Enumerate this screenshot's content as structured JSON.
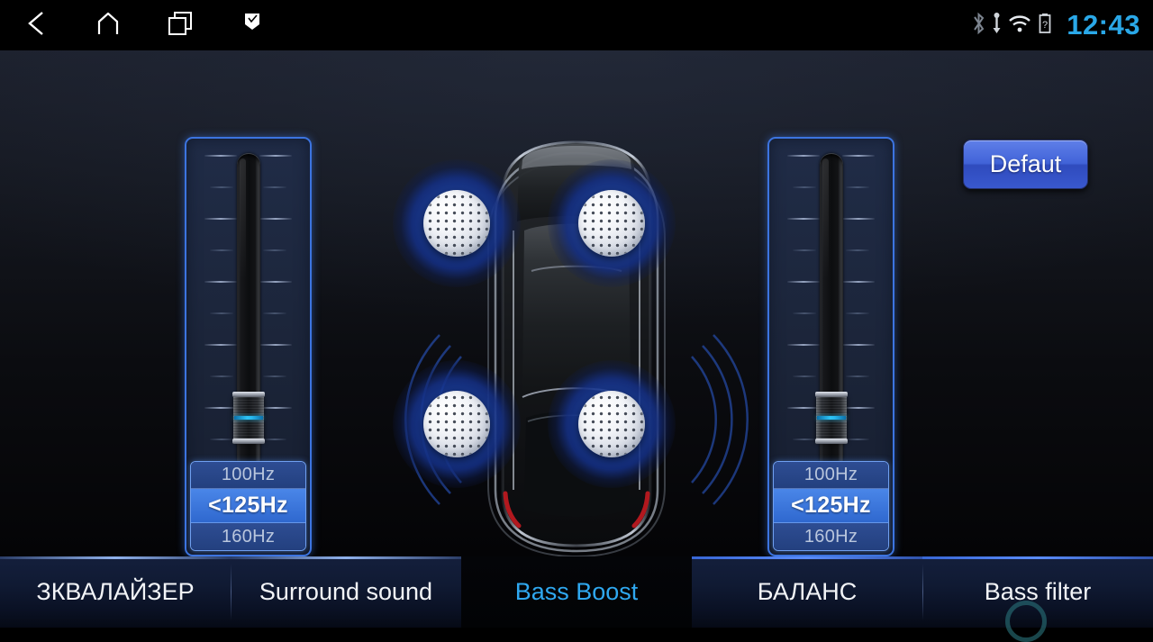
{
  "statusbar": {
    "nav": [
      {
        "name": "back-icon",
        "label": "back"
      },
      {
        "name": "home-icon",
        "label": "home"
      },
      {
        "name": "recent-apps-icon",
        "label": "recent apps"
      },
      {
        "name": "flag-icon",
        "label": "flag"
      }
    ],
    "indicators": [
      {
        "name": "bluetooth-icon",
        "label": "bluetooth"
      },
      {
        "name": "usb-icon",
        "label": "usb"
      },
      {
        "name": "wifi-icon",
        "label": "wifi"
      },
      {
        "name": "battery-unknown-icon",
        "label": "battery"
      }
    ],
    "clock": "12:43",
    "clock_color": "#2aa8e8"
  },
  "default_button": {
    "label": "Defaut"
  },
  "sliders": [
    {
      "id": "bass-boost-left",
      "level_percent": 8,
      "frequencies": [
        {
          "label": "100Hz",
          "selected": false
        },
        {
          "label": "<125Hz",
          "selected": true
        },
        {
          "label": "160Hz",
          "selected": false
        }
      ]
    },
    {
      "id": "bass-boost-right",
      "level_percent": 8,
      "frequencies": [
        {
          "label": "100Hz",
          "selected": false
        },
        {
          "label": "<125Hz",
          "selected": true
        },
        {
          "label": "160Hz",
          "selected": false
        }
      ]
    }
  ],
  "car_diagram": {
    "speakers": [
      {
        "position": "front-left",
        "name": "speaker-front-left"
      },
      {
        "position": "front-right",
        "name": "speaker-front-right"
      },
      {
        "position": "rear-left",
        "name": "speaker-rear-left"
      },
      {
        "position": "rear-right",
        "name": "speaker-rear-right"
      }
    ]
  },
  "tabs": [
    {
      "label": "ЗКВАЛАЙЗЕР",
      "active": false,
      "name": "tab-equalizer"
    },
    {
      "label": "Surround sound",
      "active": false,
      "name": "tab-surround-sound"
    },
    {
      "label": "Bass Boost",
      "active": true,
      "name": "tab-bass-boost"
    },
    {
      "label": "БАЛАНС",
      "active": false,
      "name": "tab-balance"
    },
    {
      "label": "Bass filter",
      "active": false,
      "name": "tab-bass-filter"
    }
  ],
  "colors": {
    "accent_blue": "#3c74e0",
    "active_tab_text": "#2fa8f0",
    "panel_bg": "#1b2438",
    "selected_freq": "#4a86e8"
  }
}
